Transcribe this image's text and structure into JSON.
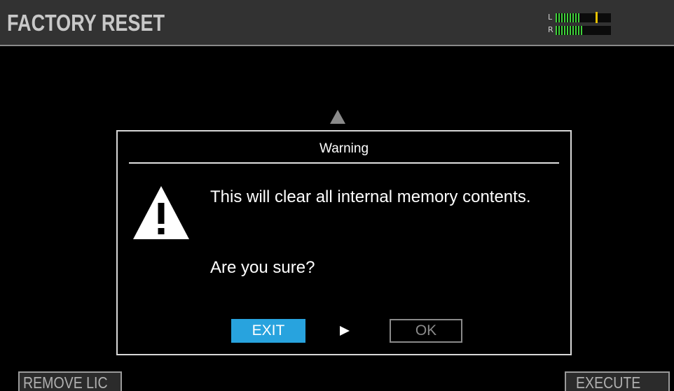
{
  "header": {
    "title": "FACTORY RESET"
  },
  "level_meter": {
    "left_label": "L",
    "right_label": "R",
    "left_level": 0.45,
    "right_level": 0.5,
    "left_peak": 0.72,
    "colors": {
      "fill": "#3fd13a",
      "peak": "#e6c000"
    }
  },
  "dialog": {
    "title": "Warning",
    "icon": "warning-triangle-icon",
    "message": "This will clear all internal memory contents.",
    "question": "Are you sure?",
    "exit_label": "EXIT",
    "ok_label": "OK",
    "selection_arrow_icon": "right-arrow-icon"
  },
  "softkeys": {
    "left_label": "REMOVE LIC",
    "right_label": "EXECUTE"
  },
  "colors": {
    "accent": "#28a3de",
    "header_bg": "#323232"
  }
}
